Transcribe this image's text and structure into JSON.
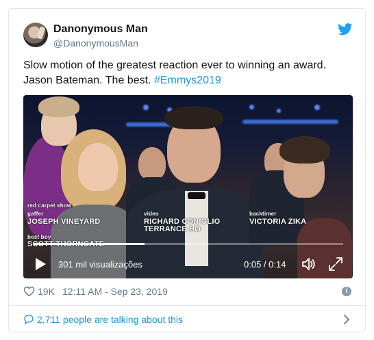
{
  "tweet": {
    "author_name": "Danonymous Man",
    "author_handle": "@DanonymousMan",
    "text_main": "Slow motion of the greatest reaction ever to winning an award. Jason Bateman. The best. ",
    "hashtag": "#Emmys2019"
  },
  "video": {
    "captions": {
      "red_carpet_show": "red carpet show",
      "gaffer": "gaffer",
      "gaffer_name": "JOSEPH VINEYARD",
      "best_boy": "best boy",
      "best_boy_name": "SCOTT THORNGATE",
      "video": "video",
      "video_name_1": "RICHARD CONIGLIO",
      "video_name_2": "TERRANCE HO",
      "backtimer": "backtimer",
      "backtimer_name": "VICTORIA ZIKA"
    },
    "views": "301 mil visualizações",
    "time": "0:05 / 0:14",
    "progress_fraction": 0.36,
    "icons": [
      "play-icon",
      "volume-icon",
      "fullscreen-icon"
    ]
  },
  "meta": {
    "likes": "19K",
    "timestamp": "12:11 AM - Sep 23, 2019",
    "info_glyph": "i"
  },
  "footer": {
    "talking": "2,711 people are talking about this"
  },
  "colors": {
    "link_blue": "#1b95e0",
    "twitter_blue": "#1da1f2",
    "muted": "#657786",
    "border": "#e1e8ed"
  }
}
